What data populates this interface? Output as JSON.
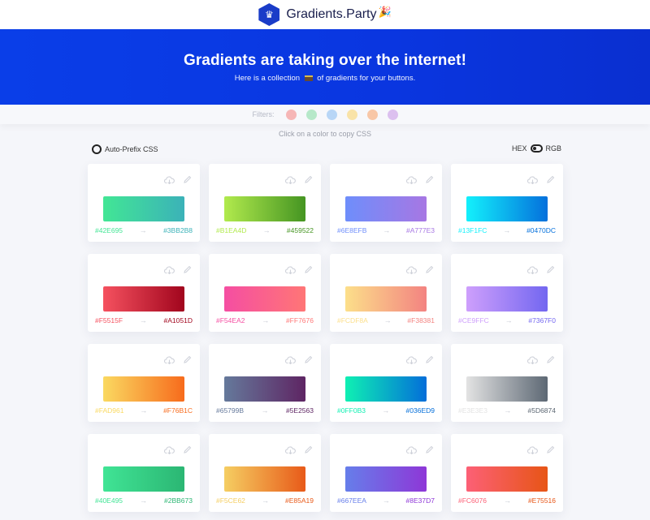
{
  "header": {
    "brand": "Gradients.Party",
    "logo_glyph": "♛",
    "brand_emoji": "🎉"
  },
  "hero": {
    "title": "Gradients are taking over the internet!",
    "subtitle_before": "Here is a collection",
    "subtitle_after": "of gradients for your buttons."
  },
  "filters": {
    "label": "Filters:",
    "colors": [
      "#f6b6b6",
      "#b6e8c9",
      "#b8d6f6",
      "#f9e3a8",
      "#f8c7a7",
      "#dcc0ef"
    ]
  },
  "hint": "Click on a color to copy CSS",
  "options": {
    "auto_prefix": "Auto-Prefix CSS",
    "hex": "HEX",
    "rgb": "RGB"
  },
  "arrow": "→",
  "cards": [
    {
      "from": "#42E695",
      "to": "#3BB2B8"
    },
    {
      "from": "#B1EA4D",
      "to": "#459522"
    },
    {
      "from": "#6E8EFB",
      "to": "#A777E3"
    },
    {
      "from": "#13F1FC",
      "to": "#0470DC"
    },
    {
      "from": "#F5515F",
      "to": "#A1051D"
    },
    {
      "from": "#F54EA2",
      "to": "#FF7676"
    },
    {
      "from": "#FCDF8A",
      "to": "#F38381"
    },
    {
      "from": "#CE9FFC",
      "to": "#7367F0"
    },
    {
      "from": "#FAD961",
      "to": "#F76B1C"
    },
    {
      "from": "#65799B",
      "to": "#5E2563"
    },
    {
      "from": "#0FF0B3",
      "to": "#036ED9"
    },
    {
      "from": "#E3E3E3",
      "to": "#5D6874"
    },
    {
      "from": "#40E495",
      "to": "#2BB673"
    },
    {
      "from": "#F5CE62",
      "to": "#E85A19"
    },
    {
      "from": "#667EEA",
      "to": "#8E37D7"
    },
    {
      "from": "#FC6076",
      "to": "#E75516"
    }
  ]
}
